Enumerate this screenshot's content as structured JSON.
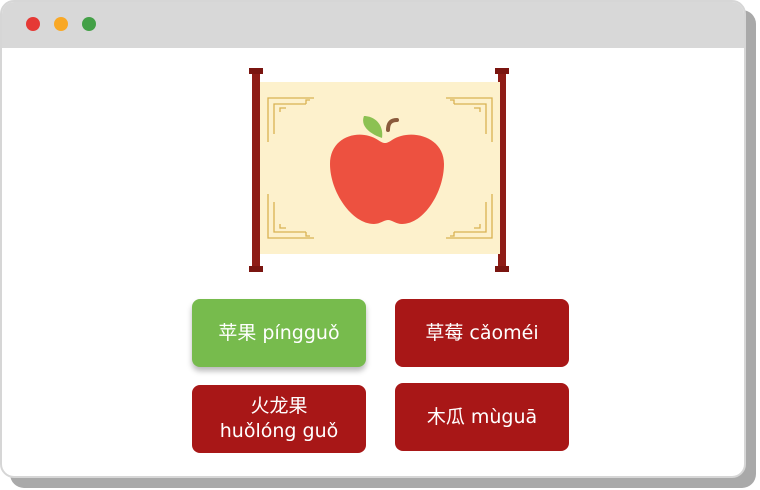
{
  "window": {
    "controls": [
      {
        "name": "close",
        "color": "#e53935"
      },
      {
        "name": "minimize",
        "color": "#f9a825"
      },
      {
        "name": "maximize",
        "color": "#43a047"
      }
    ]
  },
  "prompt": {
    "icon": "apple-icon",
    "frame": "hanging-scroll"
  },
  "choices": [
    {
      "label": "苹果 píngguǒ",
      "state": "correct",
      "color": "#77bb4d"
    },
    {
      "label": "草莓 cǎoméi",
      "state": "default",
      "color": "#a81717"
    },
    {
      "line1": "火龙果",
      "line2": "huǒlóng guǒ",
      "state": "default",
      "color": "#a81717"
    },
    {
      "label": "木瓜 mùguā",
      "state": "default",
      "color": "#a81717"
    }
  ]
}
